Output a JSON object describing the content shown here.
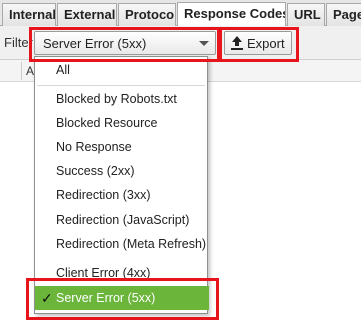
{
  "tabs": [
    {
      "label": "Internal"
    },
    {
      "label": "External"
    },
    {
      "label": "Protocol"
    },
    {
      "label": "Response Codes",
      "active": true
    },
    {
      "label": "URL"
    },
    {
      "label": "Page"
    }
  ],
  "toolbar": {
    "filter_label": "Filter:",
    "filter_value": "Server Error (5xx)",
    "export_label": "Export"
  },
  "column_header": {
    "first_letter": "A"
  },
  "dropdown": {
    "options": [
      {
        "label": "All"
      },
      {
        "label": "Blocked by Robots.txt"
      },
      {
        "label": "Blocked Resource"
      },
      {
        "label": "No Response"
      },
      {
        "label": "Success (2xx)"
      },
      {
        "label": "Redirection (3xx)"
      },
      {
        "label": "Redirection (JavaScript)"
      },
      {
        "label": "Redirection (Meta Refresh)"
      },
      {
        "label": "Client Error (4xx)"
      },
      {
        "label": "Server Error (5xx)",
        "selected": true
      }
    ],
    "check_mark": "✓"
  },
  "colors": {
    "selected_bg": "#6ab53a",
    "highlight_border": "#e8141c"
  },
  "icons": {
    "dropdown": "chevron-down-icon",
    "export": "upload-icon",
    "selected": "check-icon"
  }
}
